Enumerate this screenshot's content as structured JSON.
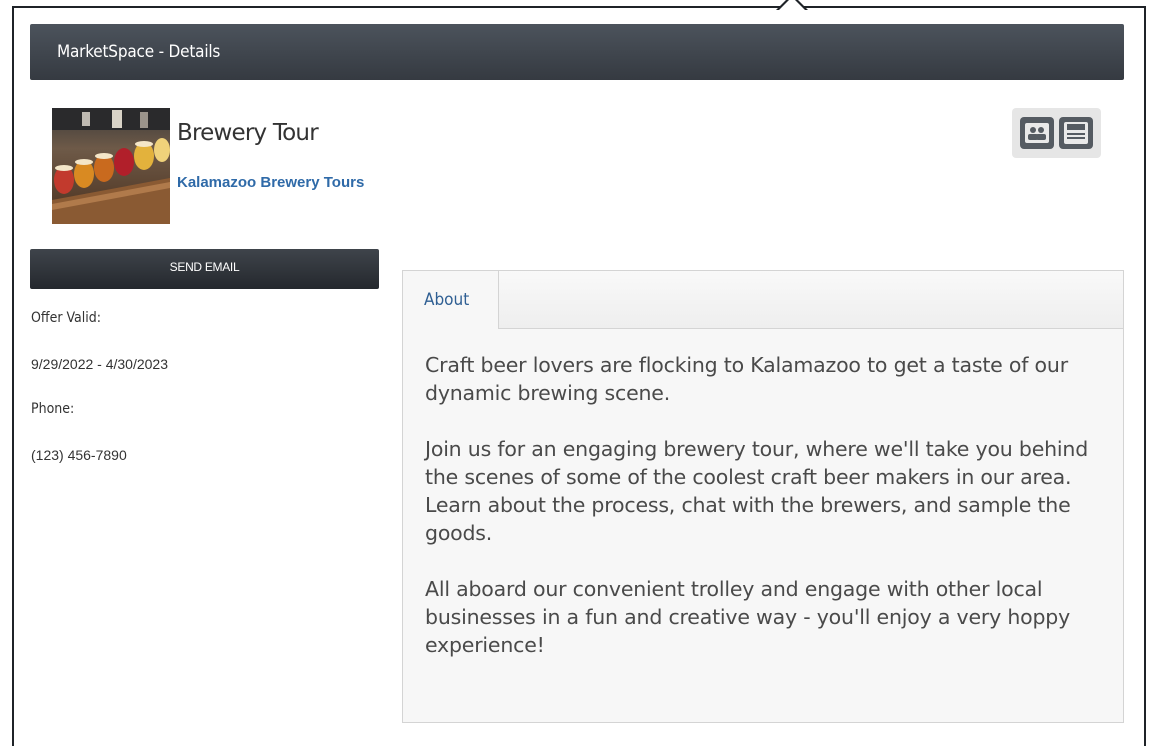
{
  "header": {
    "title": "MarketSpace - Details"
  },
  "listing": {
    "title": "Brewery Tour",
    "vendor": "Kalamazoo Brewery Tours",
    "thumbnail_icon": "beer-flight-photo"
  },
  "actions": {
    "icons": [
      "contacts-icon",
      "save-icon"
    ]
  },
  "sidebar": {
    "send_email_label": "SEND EMAIL",
    "offer_valid_label": "Offer Valid:",
    "offer_valid_value": "9/29/2022 - 4/30/2023",
    "phone_label": "Phone:",
    "phone_value": "(123) 456-7890"
  },
  "tabs": {
    "active": "About",
    "items": [
      {
        "label": "About"
      }
    ]
  },
  "about": {
    "paragraphs": [
      "Craft beer lovers are flocking to Kalamazoo to get a taste of our dynamic brewing scene.",
      "Join us for an engaging brewery tour, where we'll take you behind the scenes of some of the coolest craft beer makers in our area. Learn about the process, chat with the brewers, and sample the goods.",
      "All aboard our convenient trolley and engage with other local businesses in a fun and creative way - you'll enjoy a very hoppy experience!"
    ]
  },
  "colors": {
    "header_bg": "#3f454c",
    "link": "#2f6aa8",
    "tab_label": "#2f5f93"
  }
}
